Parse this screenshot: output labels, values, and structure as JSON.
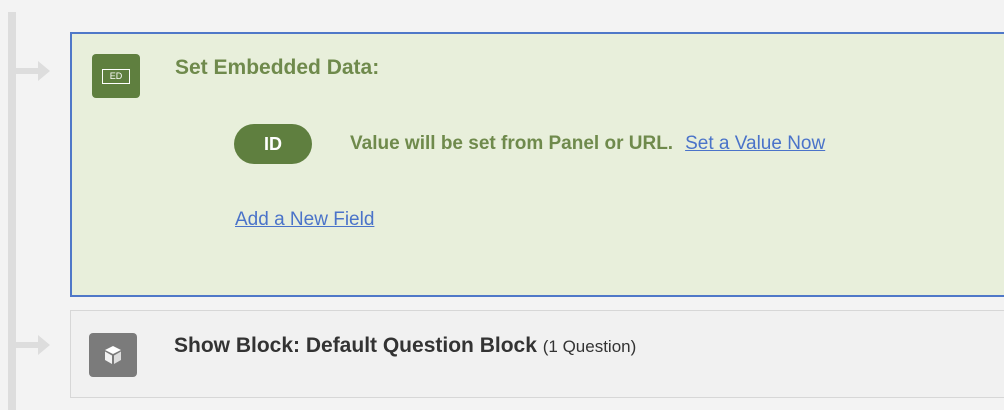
{
  "flow": {
    "embedded_data": {
      "icon": "embedded-data-icon",
      "icon_text": "ED",
      "title": "Set Embedded Data:",
      "field": {
        "name": "ID",
        "note": "Value will be set from Panel or URL.",
        "set_value_link": "Set a Value Now"
      },
      "add_field_link": "Add a New Field"
    },
    "show_block": {
      "icon": "cube-icon",
      "title": "Show Block: Default Question Block",
      "count": "(1 Question)"
    }
  },
  "colors": {
    "embedded_bg": "#e8efdb",
    "embedded_border": "#4f78c8",
    "green": "#5f7f3f",
    "green_text": "#6f8a4c",
    "link": "#4a73c9",
    "block_icon": "#7b7b7b"
  }
}
